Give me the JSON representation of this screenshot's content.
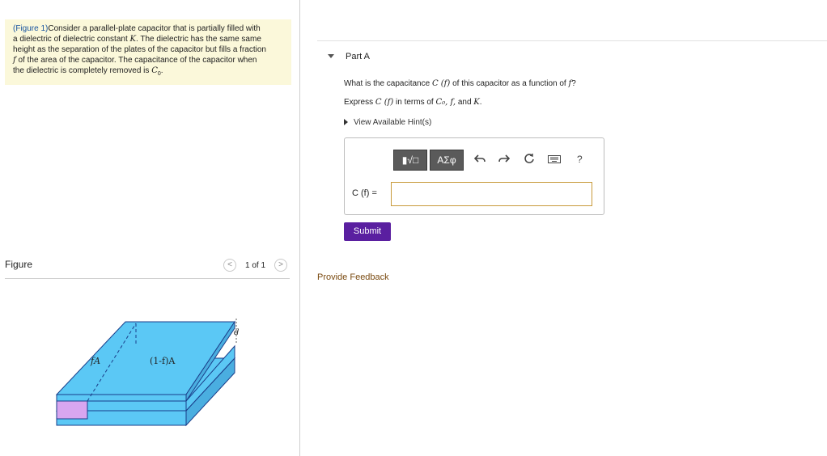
{
  "statement": {
    "figure_link": "(Figure 1)",
    "line1": "Consider a parallel-plate capacitor that is partially filled with",
    "line2_pre": "a dielectric of dielectric constant ",
    "line2_var": "K",
    "line2_post": ". The dielectric has the same same",
    "line3": "height as the separation of the plates of the capacitor but fills a fraction",
    "line4_var": "f",
    "line4_post": " of the area of the capacitor. The capacitance of the capacitor when",
    "line5_pre": "the dielectric is completely removed is ",
    "line5_var": "C",
    "line5_sub": "0",
    "line5_post": "."
  },
  "figure": {
    "title": "Figure",
    "pager_prev": "<",
    "pager_text": "1 of 1",
    "pager_next": ">",
    "label_fa": "fA",
    "label_rest": "(1-f)A",
    "label_d": "d"
  },
  "part_a": {
    "title": "Part A",
    "question_pre": "What is the capacitance ",
    "question_expr": "C (f)",
    "question_mid": " of this capacitor as a function of ",
    "question_var": "f",
    "question_post": "?",
    "express_pre": "Express ",
    "express_expr": "C (f)",
    "express_mid": " in terms of ",
    "express_terms": "C₀, f,",
    "express_and": " and ",
    "express_k": "K",
    "express_post": ".",
    "hints_label": "View Available Hint(s)"
  },
  "toolbar": {
    "templates_label": "▮√□",
    "greek_label": "AΣφ",
    "undo_icon": "undo-icon",
    "redo_icon": "redo-icon",
    "reset_icon": "reset-icon",
    "keyboard_icon": "keyboard-icon",
    "help_label": "?"
  },
  "answer": {
    "label": "C (f) =",
    "value": ""
  },
  "submit_label": "Submit",
  "feedback_label": "Provide Feedback",
  "colors": {
    "statement_bg": "#fbf8da",
    "submit_bg": "#5a1fa0",
    "plate_blue": "#5bc8f5",
    "dielectric_purple": "#d8a6f0",
    "feedback_link": "#7a4a10"
  }
}
